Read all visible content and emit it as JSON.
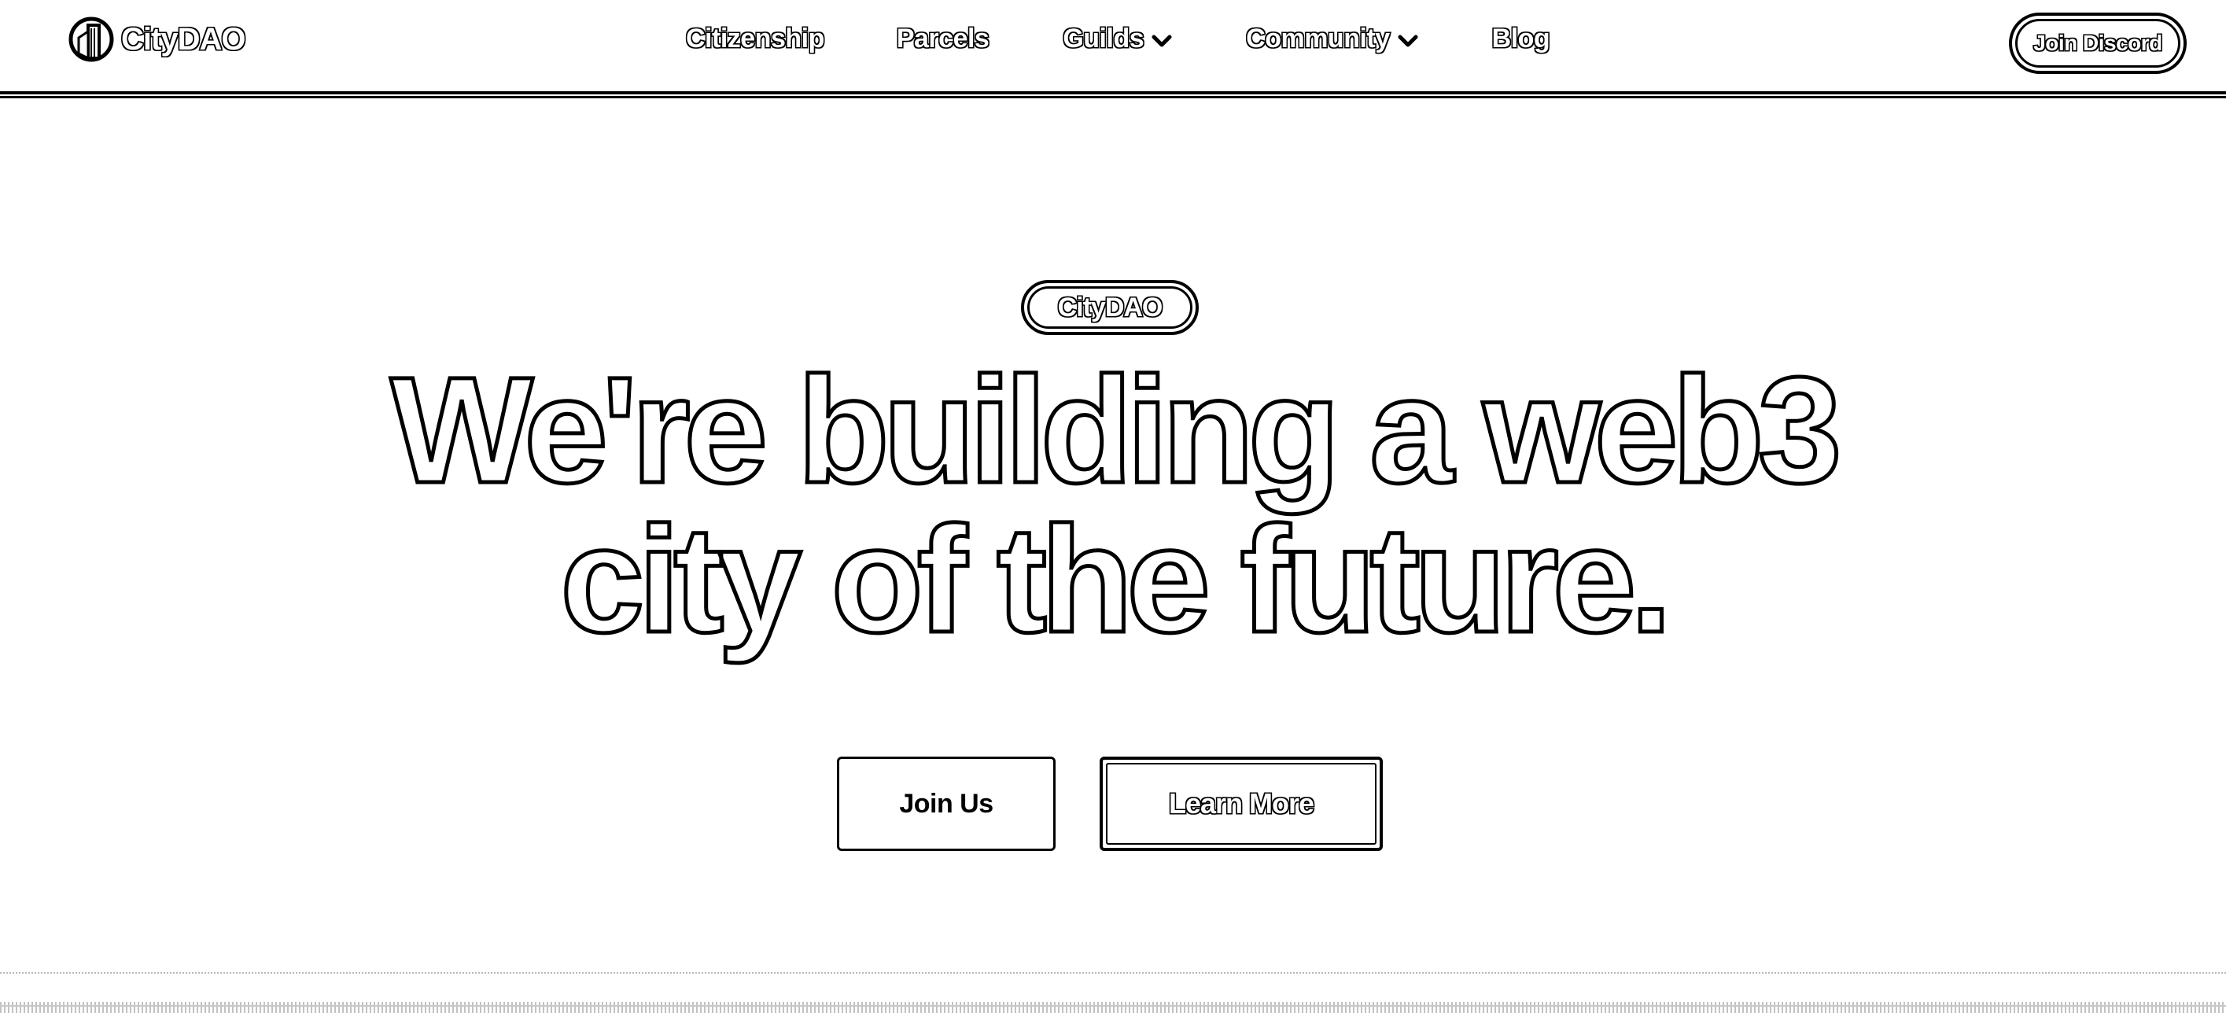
{
  "brand": {
    "name": "CityDAO",
    "logo_icon": "city-building-icon"
  },
  "nav": {
    "items": [
      {
        "label": "Citizenship",
        "has_dropdown": false
      },
      {
        "label": "Parcels",
        "has_dropdown": false
      },
      {
        "label": "Guilds",
        "has_dropdown": true
      },
      {
        "label": "Community",
        "has_dropdown": true
      },
      {
        "label": "Blog",
        "has_dropdown": false
      }
    ],
    "discord_label": "Join Discord"
  },
  "hero": {
    "badge": "CityDAO",
    "title_line_1": "We're building a web3",
    "title_line_2": "city of the future.",
    "primary_cta": "Join Us",
    "secondary_cta": "Learn More"
  },
  "colors": {
    "background": "#ffffff",
    "ink": "#000000"
  }
}
